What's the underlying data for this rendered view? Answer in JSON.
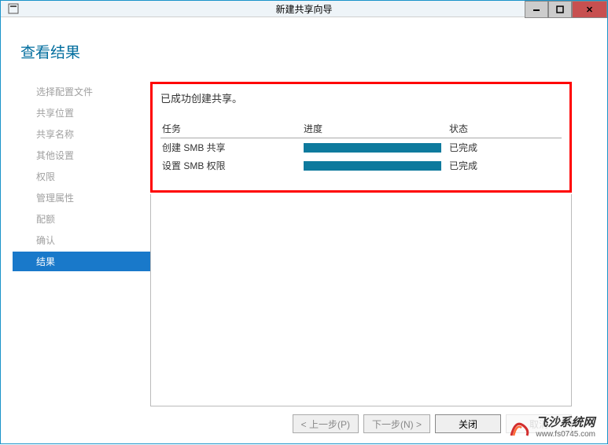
{
  "window": {
    "title": "新建共享向导"
  },
  "page": {
    "title": "查看结果"
  },
  "sidebar": {
    "items": [
      {
        "label": "选择配置文件"
      },
      {
        "label": "共享位置"
      },
      {
        "label": "共享名称"
      },
      {
        "label": "其他设置"
      },
      {
        "label": "权限"
      },
      {
        "label": "管理属性"
      },
      {
        "label": "配额"
      },
      {
        "label": "确认"
      },
      {
        "label": "结果"
      }
    ],
    "active_index": 8
  },
  "main": {
    "success_message": "已成功创建共享。",
    "columns": {
      "task": "任务",
      "progress": "进度",
      "status": "状态"
    },
    "rows": [
      {
        "task": "创建 SMB 共享",
        "status": "已完成",
        "progress_pct": 100
      },
      {
        "task": "设置 SMB 权限",
        "status": "已完成",
        "progress_pct": 100
      }
    ]
  },
  "footer": {
    "prev": "< 上一步(P)",
    "next": "下一步(N) >",
    "close": "关闭",
    "cancel": "取消"
  },
  "watermark": {
    "title": "飞沙系统网",
    "url": "www.fs0745.com"
  }
}
